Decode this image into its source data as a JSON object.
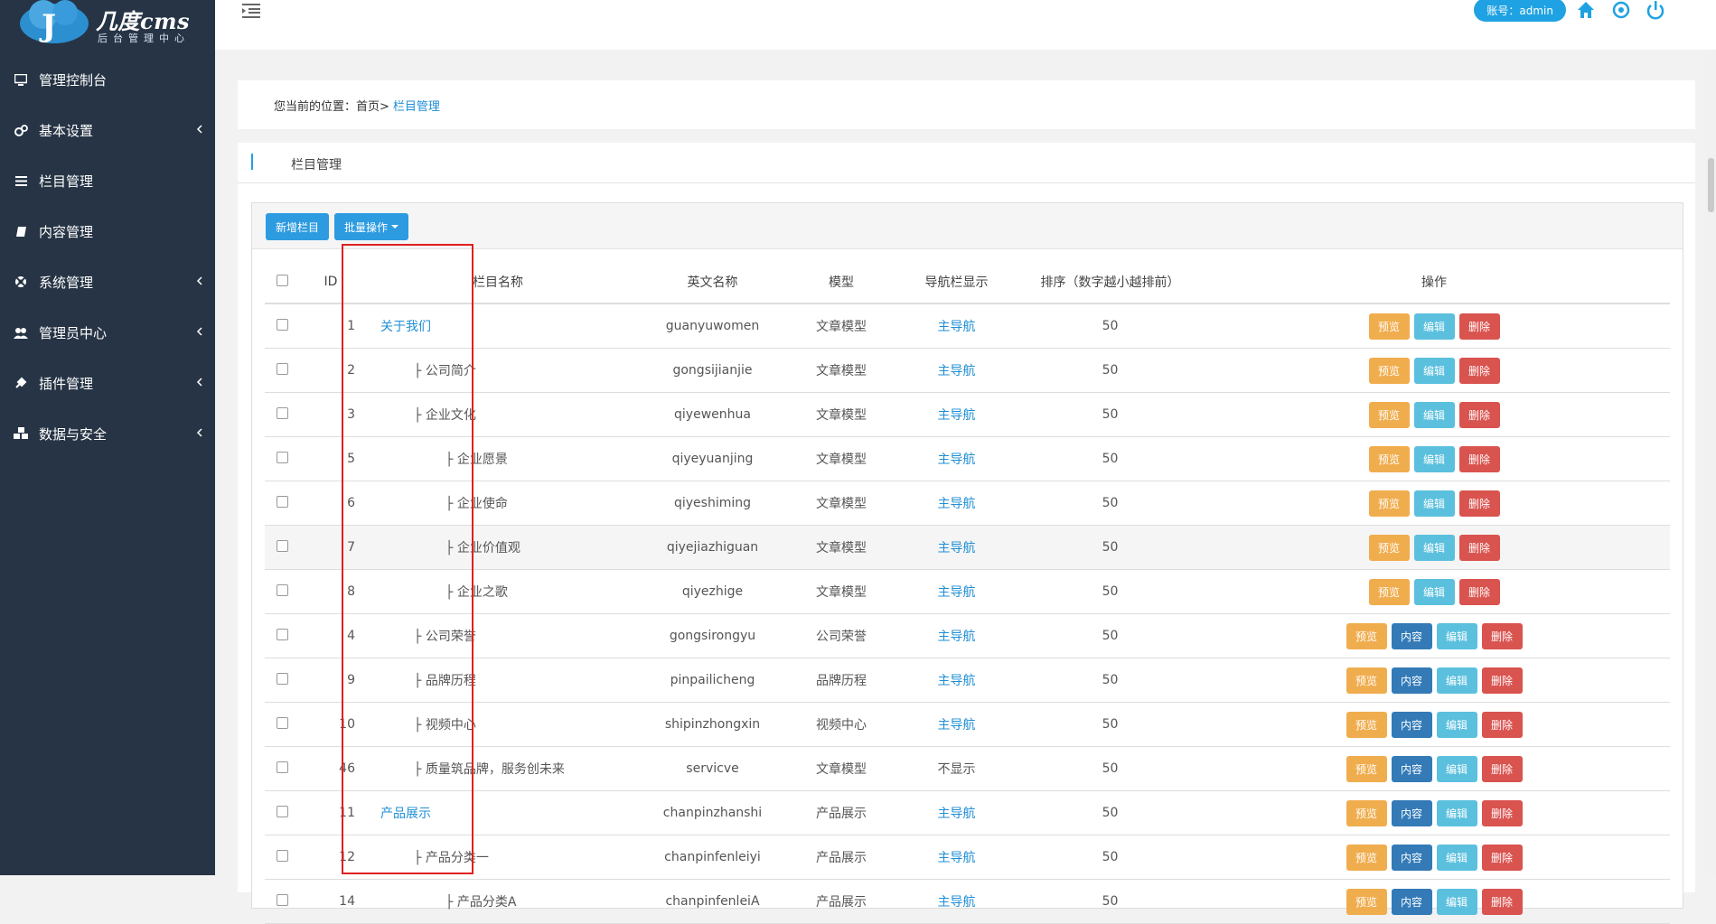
{
  "brand": {
    "title": "几度cms",
    "subtitle": "后台管理中心"
  },
  "sidebar": {
    "items": [
      {
        "label": "管理控制台",
        "icon": "monitor-icon",
        "has_arrow": false
      },
      {
        "label": "基本设置",
        "icon": "cogs-icon",
        "has_arrow": true
      },
      {
        "label": "栏目管理",
        "icon": "list-icon",
        "has_arrow": false
      },
      {
        "label": "内容管理",
        "icon": "book-icon",
        "has_arrow": false
      },
      {
        "label": "系统管理",
        "icon": "life-ring-icon",
        "has_arrow": true
      },
      {
        "label": "管理员中心",
        "icon": "users-icon",
        "has_arrow": true
      },
      {
        "label": "插件管理",
        "icon": "plug-icon",
        "has_arrow": true
      },
      {
        "label": "数据与安全",
        "icon": "cubes-icon",
        "has_arrow": true
      }
    ]
  },
  "topbar": {
    "account": "账号：admin"
  },
  "breadcrumb": {
    "prefix": "您当前的位置：首页>",
    "current": "栏目管理"
  },
  "panel": {
    "title": "栏目管理"
  },
  "toolbar": {
    "add_label": "新增栏目",
    "batch_label": "批量操作"
  },
  "table": {
    "headers": [
      "ID",
      "栏目名称",
      "英文名称",
      "模型",
      "导航栏显示",
      "排序（数字越小越排前）",
      "操作"
    ],
    "rows": [
      {
        "id": "1",
        "name": "关于我们",
        "level": "top",
        "en": "guanyuwomen",
        "model": "文章模型",
        "nav": "主导航",
        "sort": "50",
        "content_btn": false
      },
      {
        "id": "2",
        "name": "├ 公司简介",
        "level": "l1",
        "en": "gongsijianjie",
        "model": "文章模型",
        "nav": "主导航",
        "sort": "50",
        "content_btn": false
      },
      {
        "id": "3",
        "name": "├ 企业文化",
        "level": "l1",
        "en": "qiyewenhua",
        "model": "文章模型",
        "nav": "主导航",
        "sort": "50",
        "content_btn": false
      },
      {
        "id": "5",
        "name": "├ 企业愿景",
        "level": "l2",
        "en": "qiyeyuanjing",
        "model": "文章模型",
        "nav": "主导航",
        "sort": "50",
        "content_btn": false
      },
      {
        "id": "6",
        "name": "├ 企业使命",
        "level": "l2",
        "en": "qiyeshiming",
        "model": "文章模型",
        "nav": "主导航",
        "sort": "50",
        "content_btn": false
      },
      {
        "id": "7",
        "name": "├ 企业价值观",
        "level": "l2",
        "en": "qiyejiazhiguan",
        "model": "文章模型",
        "nav": "主导航",
        "sort": "50",
        "content_btn": false
      },
      {
        "id": "8",
        "name": "├ 企业之歌",
        "level": "l2",
        "en": "qiyezhige",
        "model": "文章模型",
        "nav": "主导航",
        "sort": "50",
        "content_btn": false
      },
      {
        "id": "4",
        "name": "├ 公司荣誉",
        "level": "l1",
        "en": "gongsirongyu",
        "model": "公司荣誉",
        "nav": "主导航",
        "sort": "50",
        "content_btn": true
      },
      {
        "id": "9",
        "name": "├ 品牌历程",
        "level": "l1",
        "en": "pinpailicheng",
        "model": "品牌历程",
        "nav": "主导航",
        "sort": "50",
        "content_btn": true
      },
      {
        "id": "10",
        "name": "├ 视频中心",
        "level": "l1",
        "en": "shipinzhongxin",
        "model": "视频中心",
        "nav": "主导航",
        "sort": "50",
        "content_btn": true
      },
      {
        "id": "46",
        "name": "├ 质量筑品牌，服务创未来",
        "level": "l1",
        "en": "servicve",
        "model": "文章模型",
        "nav": "不显示",
        "sort": "50",
        "content_btn": true
      },
      {
        "id": "11",
        "name": "产品展示",
        "level": "top",
        "en": "chanpinzhanshi",
        "model": "产品展示",
        "nav": "主导航",
        "sort": "50",
        "content_btn": true
      },
      {
        "id": "12",
        "name": "├ 产品分类一",
        "level": "l1",
        "en": "chanpinfenleiyi",
        "model": "产品展示",
        "nav": "主导航",
        "sort": "50",
        "content_btn": true
      },
      {
        "id": "14",
        "name": "├ 产品分类A",
        "level": "l2",
        "en": "chanpinfenleiA",
        "model": "产品展示",
        "nav": "主导航",
        "sort": "50",
        "content_btn": true
      }
    ],
    "ops": {
      "preview": "预览",
      "content": "内容",
      "edit": "编辑",
      "delete": "删除"
    }
  },
  "colors": {
    "sidebar": "#263445",
    "accent": "#1fa2e3",
    "annotation_box": "#e02020"
  }
}
